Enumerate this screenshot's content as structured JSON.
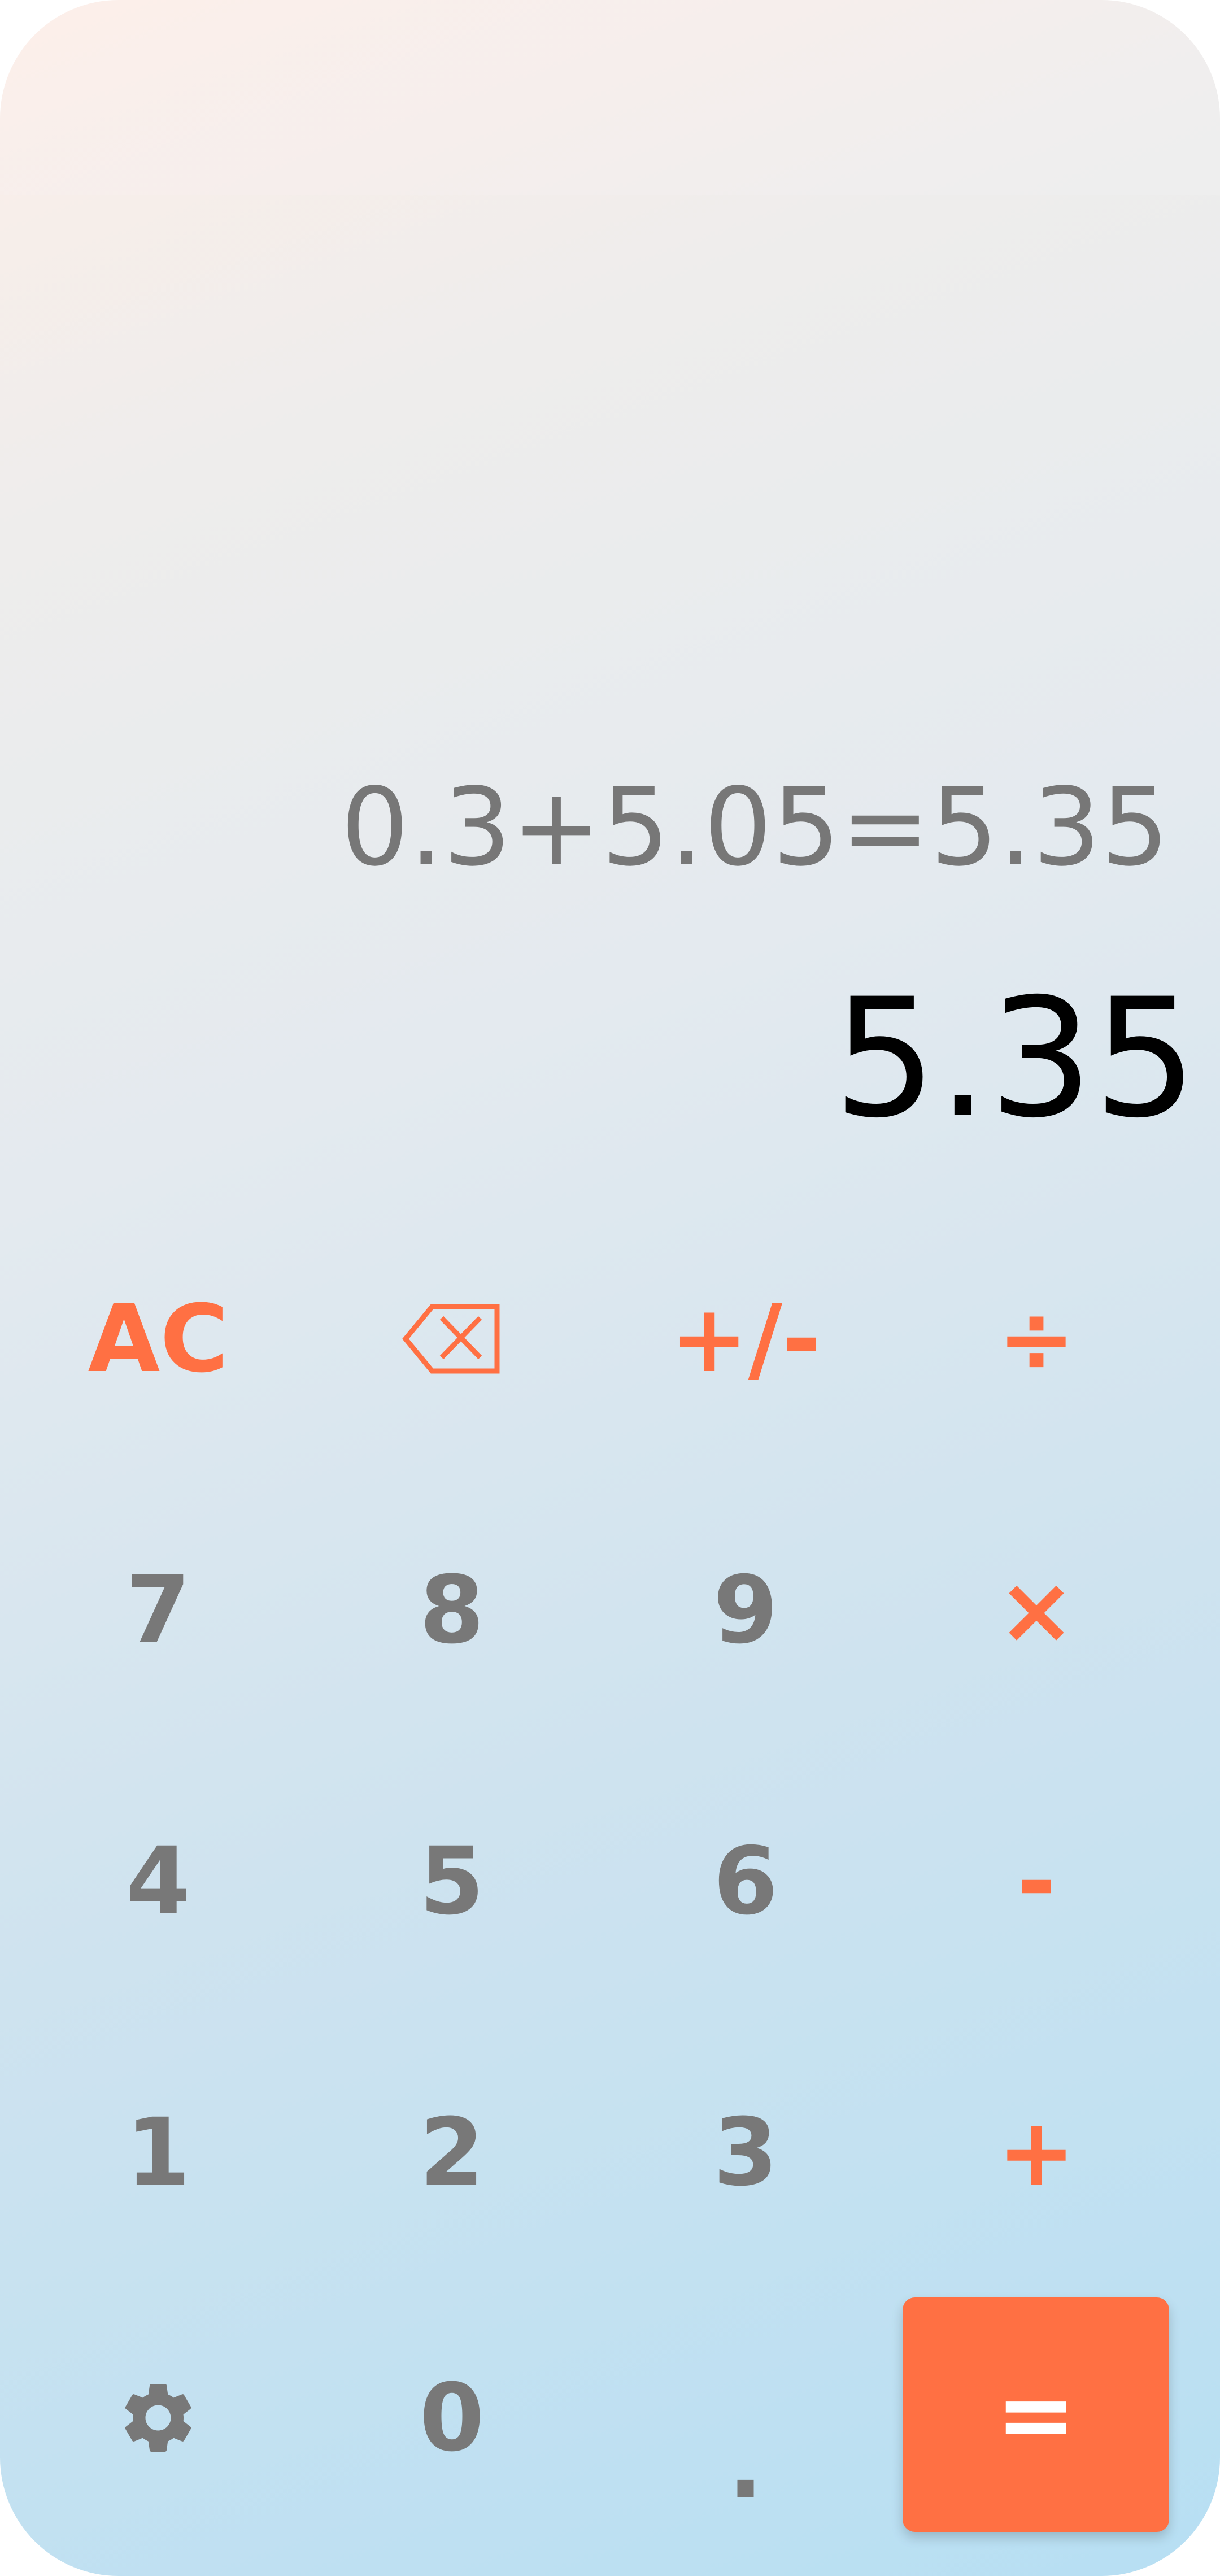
{
  "display": {
    "expression": "0.3+5.05=5.35",
    "result": "5.35"
  },
  "keypad": {
    "clear": "AC",
    "backspace_icon": "backspace-icon",
    "sign": "+/-",
    "divide": "÷",
    "seven": "7",
    "eight": "8",
    "nine": "9",
    "multiply": "×",
    "four": "4",
    "five": "5",
    "six": "6",
    "subtract": "-",
    "one": "1",
    "two": "2",
    "three": "3",
    "add": "+",
    "settings_icon": "gear-icon",
    "zero": "0",
    "decimal": ".",
    "equals": "="
  },
  "colors": {
    "accent": "#ff7043",
    "digit": "#787878",
    "expression": "#777777",
    "result": "#000000",
    "equals_text": "#ffffff"
  }
}
